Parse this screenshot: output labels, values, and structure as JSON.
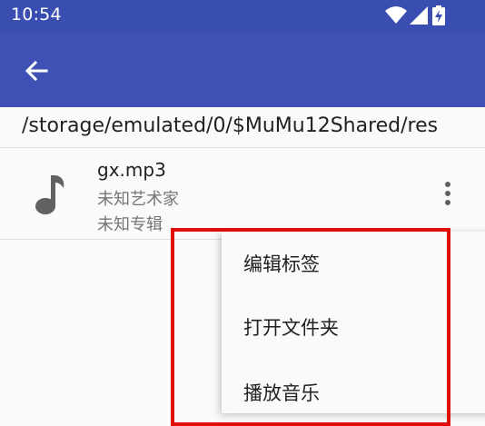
{
  "status_bar": {
    "time": "10:54",
    "icons": [
      "wifi-icon",
      "signal-icon",
      "battery-charging-icon"
    ]
  },
  "app_bar": {
    "back_icon": "arrow-left-icon",
    "color": "#3f51b5",
    "status_color": "#3a4db1"
  },
  "path": {
    "text": "/storage/emulated/0/$MuMu12Shared/res"
  },
  "file": {
    "icon": "music-note-icon",
    "name": "gx.mp3",
    "artist": "未知艺术家",
    "album": "未知专辑",
    "more_icon": "more-vertical-icon"
  },
  "context_menu": {
    "items": [
      {
        "label": "编辑标签"
      },
      {
        "label": "打开文件夹"
      },
      {
        "label": "播放音乐"
      }
    ]
  },
  "highlight": {
    "color": "#e00d0d"
  }
}
